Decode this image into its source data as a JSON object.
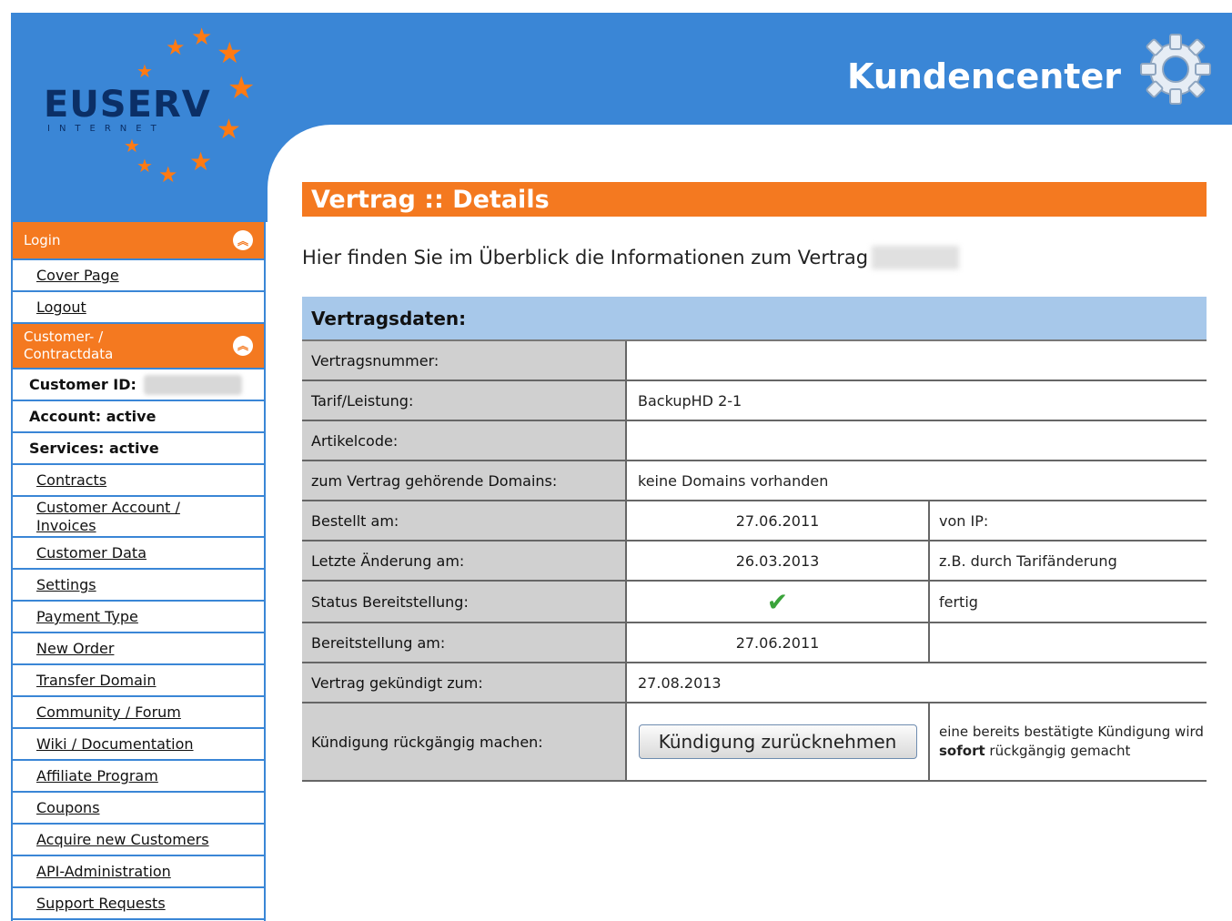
{
  "header": {
    "logo_text": "EUSERV",
    "logo_sub": "INTERNET",
    "title": "Kundencenter"
  },
  "sidebar": {
    "login_header": "Login",
    "login_items": [
      "Cover Page",
      "Logout"
    ],
    "customer_header": "Customer- / Contractdata",
    "customer_id_label": "Customer ID:",
    "account_status": "Account: active",
    "services_status": "Services: active",
    "items": [
      "Contracts",
      "Customer Account / Invoices",
      "Customer Data",
      "Settings",
      "Payment Type",
      "New Order",
      "Transfer Domain",
      "Community / Forum",
      "Wiki / Documentation",
      "Affiliate Program",
      "Coupons",
      "Acquire new Customers",
      "API-Administration",
      "Support Requests"
    ]
  },
  "main": {
    "title": "Vertrag :: Details",
    "intro": "Hier finden Sie im Überblick die Informationen zum Vertrag",
    "table_header": "Vertragsdaten:",
    "rows": {
      "vertragsnummer": {
        "label": "Vertragsnummer:",
        "value": ""
      },
      "tarif": {
        "label": "Tarif/Leistung:",
        "value": "BackupHD 2-1"
      },
      "artikelcode": {
        "label": "Artikelcode:",
        "value": ""
      },
      "domains": {
        "label": "zum Vertrag gehörende Domains:",
        "value": "keine Domains vorhanden"
      },
      "bestellt": {
        "label": "Bestellt am:",
        "value": "27.06.2011",
        "extra": "von IP:"
      },
      "aenderung": {
        "label": "Letzte Änderung am:",
        "value": "26.03.2013",
        "extra": "z.B. durch Tarifänderung"
      },
      "status": {
        "label": "Status Bereitstellung:",
        "extra": "fertig"
      },
      "bereitstellung": {
        "label": "Bereitstellung am:",
        "value": "27.06.2011",
        "extra": ""
      },
      "gekuendigt": {
        "label": "Vertrag gekündigt zum:",
        "value": "27.08.2013"
      },
      "rueckgaengig": {
        "label": "Kündigung rückgängig machen:",
        "button": "Kündigung zurücknehmen",
        "note_before": "eine bereits bestätigte Kündigung wird ",
        "note_bold": "sofort",
        "note_after": " rückgängig gemacht"
      }
    }
  },
  "colors": {
    "header_blue": "#3a86d6",
    "accent_orange": "#f47920",
    "table_header_blue": "#a7c8ea",
    "label_gray": "#d0d0d0",
    "check_green": "#3aa33a"
  },
  "icons": [
    "gear-icon",
    "collapse-icon",
    "checkmark-icon",
    "star-icon"
  ]
}
